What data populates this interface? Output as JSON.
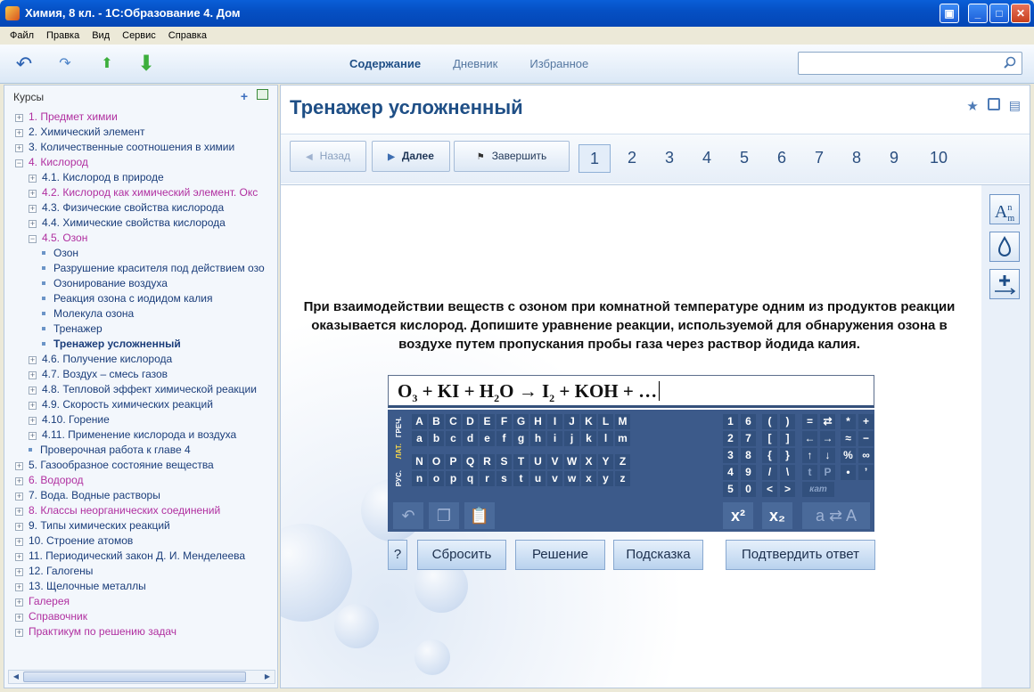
{
  "window": {
    "title": "Химия, 8 кл. - 1С:Образование 4. Дом"
  },
  "menu": [
    "Файл",
    "Правка",
    "Вид",
    "Сервис",
    "Справка"
  ],
  "toolbar": {
    "tabs": [
      "Содержание",
      "Дневник",
      "Избранное"
    ],
    "active_tab": "Содержание",
    "search_placeholder": ""
  },
  "sidebar": {
    "heading": "Курсы",
    "items": [
      {
        "label": "1. Предмет химии",
        "level": 0,
        "kind": "toggle",
        "color": "pink"
      },
      {
        "label": "2. Химический элемент",
        "level": 0,
        "kind": "toggle",
        "color": "blue"
      },
      {
        "label": "3. Количественные соотношения в химии",
        "level": 0,
        "kind": "toggle",
        "color": "blue"
      },
      {
        "label": "4. Кислород",
        "level": 0,
        "kind": "toggle-open",
        "color": "pink"
      },
      {
        "label": "4.1. Кислород в природе",
        "level": 1,
        "kind": "toggle",
        "color": "blue"
      },
      {
        "label": "4.2. Кислород как химический элемент. Окс",
        "level": 1,
        "kind": "toggle",
        "color": "pink"
      },
      {
        "label": "4.3. Физические свойства кислорода",
        "level": 1,
        "kind": "toggle",
        "color": "blue"
      },
      {
        "label": "4.4. Химические свойства кислорода",
        "level": 1,
        "kind": "toggle",
        "color": "blue"
      },
      {
        "label": "4.5. Озон",
        "level": 1,
        "kind": "toggle-open",
        "color": "pink"
      },
      {
        "label": "Озон",
        "level": 2,
        "kind": "bullet",
        "color": "blue"
      },
      {
        "label": "Разрушение красителя под действием озо",
        "level": 2,
        "kind": "bullet",
        "color": "blue"
      },
      {
        "label": "Озонирование воздуха",
        "level": 2,
        "kind": "bullet",
        "color": "blue"
      },
      {
        "label": "Реакция озона с иодидом калия",
        "level": 2,
        "kind": "bullet",
        "color": "blue"
      },
      {
        "label": "Молекула озона",
        "level": 2,
        "kind": "bullet",
        "color": "blue"
      },
      {
        "label": "Тренажер",
        "level": 2,
        "kind": "bullet",
        "color": "blue"
      },
      {
        "label": "Тренажер усложненный",
        "level": 2,
        "kind": "bullet",
        "color": "bold"
      },
      {
        "label": "4.6. Получение кислорода",
        "level": 1,
        "kind": "toggle",
        "color": "blue"
      },
      {
        "label": "4.7. Воздух – смесь газов",
        "level": 1,
        "kind": "toggle",
        "color": "blue"
      },
      {
        "label": "4.8. Тепловой эффект химической реакции",
        "level": 1,
        "kind": "toggle",
        "color": "blue"
      },
      {
        "label": "4.9. Скорость химических реакций",
        "level": 1,
        "kind": "toggle",
        "color": "blue"
      },
      {
        "label": "4.10. Горение",
        "level": 1,
        "kind": "toggle",
        "color": "blue"
      },
      {
        "label": "4.11. Применение кислорода и воздуха",
        "level": 1,
        "kind": "toggle",
        "color": "blue"
      },
      {
        "label": "Проверочная работа к главе 4",
        "level": 1,
        "kind": "bullet",
        "color": "blue"
      },
      {
        "label": "5. Газообразное состояние вещества",
        "level": 0,
        "kind": "toggle",
        "color": "blue"
      },
      {
        "label": "6. Водород",
        "level": 0,
        "kind": "toggle",
        "color": "pink"
      },
      {
        "label": "7. Вода. Водные растворы",
        "level": 0,
        "kind": "toggle",
        "color": "blue"
      },
      {
        "label": "8. Классы неорганических соединений",
        "level": 0,
        "kind": "toggle",
        "color": "pink"
      },
      {
        "label": "9. Типы химических реакций",
        "level": 0,
        "kind": "toggle",
        "color": "blue"
      },
      {
        "label": "10. Строение атомов",
        "level": 0,
        "kind": "toggle",
        "color": "blue"
      },
      {
        "label": "11. Периодический закон Д. И. Менделеева",
        "level": 0,
        "kind": "toggle",
        "color": "blue"
      },
      {
        "label": "12. Галогены",
        "level": 0,
        "kind": "toggle",
        "color": "blue"
      },
      {
        "label": "13. Щелочные металлы",
        "level": 0,
        "kind": "toggle",
        "color": "blue"
      },
      {
        "label": "Галерея",
        "level": 0,
        "kind": "toggle",
        "color": "pink"
      },
      {
        "label": "Справочник",
        "level": 0,
        "kind": "toggle",
        "color": "pink"
      },
      {
        "label": "Практикум по решению задач",
        "level": 0,
        "kind": "toggle",
        "color": "pink"
      }
    ]
  },
  "main": {
    "title": "Тренажер усложненный",
    "nav": {
      "back": "Назад",
      "next": "Далее",
      "finish": "Завершить"
    },
    "pages": [
      "1",
      "2",
      "3",
      "4",
      "5",
      "6",
      "7",
      "8",
      "9",
      "10"
    ],
    "current_page": "1",
    "question": "При взаимодействии веществ с озоном при комнатной температуре одним из продуктов реакции оказывается кислород. Допишите уравнение реакции, используемой для обнаружения озона в воздухе путем пропускания пробы газа через раствор йодида калия.",
    "equation": {
      "parts": [
        {
          "t": "O"
        },
        {
          "sub": "3"
        },
        {
          "t": " + KI + H"
        },
        {
          "sub": "2"
        },
        {
          "t": "O → I"
        },
        {
          "sub": "2"
        },
        {
          "t": " + KOH + …"
        }
      ]
    },
    "keyboard": {
      "side_labels": [
        "ГРЕЧ.",
        "ЛАТ.",
        "РУС."
      ],
      "active_side": "ЛАТ.",
      "row1": [
        "A",
        "B",
        "C",
        "D",
        "E",
        "F",
        "G",
        "H",
        "I",
        "J",
        "K",
        "L",
        "M"
      ],
      "row2": [
        "a",
        "b",
        "c",
        "d",
        "e",
        "f",
        "g",
        "h",
        "i",
        "j",
        "k",
        "l",
        "m"
      ],
      "row3": [
        "N",
        "O",
        "P",
        "Q",
        "R",
        "S",
        "T",
        "U",
        "V",
        "W",
        "X",
        "Y",
        "Z"
      ],
      "row4": [
        "n",
        "o",
        "p",
        "q",
        "r",
        "s",
        "t",
        "u",
        "v",
        "w",
        "x",
        "y",
        "z"
      ],
      "digits": [
        [
          "1",
          "6"
        ],
        [
          "2",
          "7"
        ],
        [
          "3",
          "8"
        ],
        [
          "4",
          "9"
        ],
        [
          "5",
          "0"
        ]
      ],
      "brackets": [
        [
          "(",
          ")"
        ],
        [
          "[",
          "]"
        ],
        [
          "{",
          "}"
        ],
        [
          "/",
          "\\"
        ],
        [
          "<",
          ">"
        ]
      ],
      "ops": [
        [
          "=",
          "⇄"
        ],
        [
          "←",
          "→"
        ],
        [
          "↑",
          "↓"
        ],
        [
          "t",
          "P"
        ],
        [
          "кат"
        ]
      ],
      "misc": [
        [
          "*",
          "+"
        ],
        [
          "≈",
          "−"
        ],
        [
          "%",
          "∞"
        ],
        [
          "•",
          "’"
        ]
      ],
      "sup_label": "x²",
      "sub_label": "x₂",
      "case_label": "a ⇄ A"
    },
    "buttons": {
      "help": "?",
      "reset": "Сбросить",
      "solution": "Решение",
      "hint": "Подсказка",
      "confirm": "Подтвердить ответ"
    }
  },
  "tools": [
    "Am",
    "drop",
    "plus-arrow"
  ]
}
